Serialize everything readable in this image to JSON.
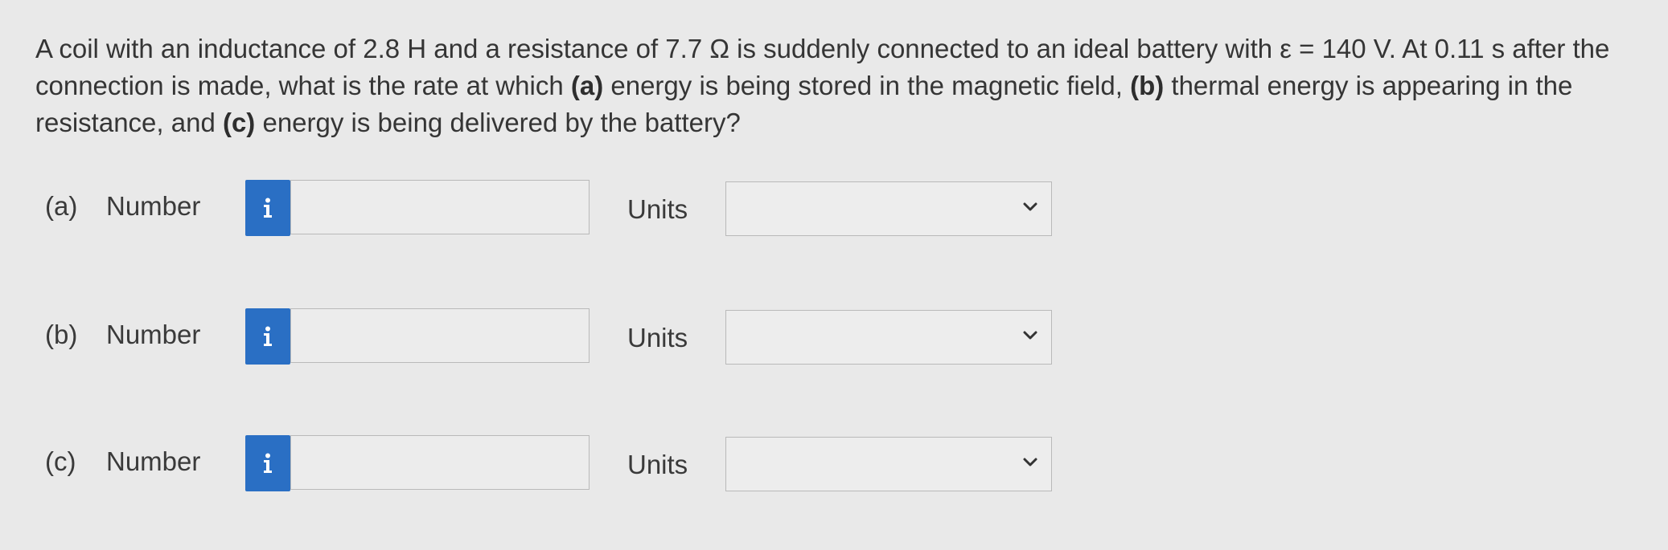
{
  "question": {
    "line1": "A coil with an inductance of 2.8 H and a resistance of 7.7 Ω is suddenly connected to an ideal battery with ε = 140 V. At 0.11 s after the",
    "line2_pre": "connection is made, what is the rate at which ",
    "line2_a": "(a)",
    "line2_mid": " energy is being stored in the magnetic field, ",
    "line2_b": "(b)",
    "line2_post": " thermal energy is appearing in the",
    "line3_pre": "resistance, and ",
    "line3_c": "(c)",
    "line3_post": " energy is being delivered by the battery?"
  },
  "parts": [
    {
      "label": "(a)",
      "number_label": "Number",
      "info": "i",
      "units_label": "Units",
      "value": "",
      "unit_selected": ""
    },
    {
      "label": "(b)",
      "number_label": "Number",
      "info": "i",
      "units_label": "Units",
      "value": "",
      "unit_selected": ""
    },
    {
      "label": "(c)",
      "number_label": "Number",
      "info": "i",
      "units_label": "Units",
      "value": "",
      "unit_selected": ""
    }
  ],
  "colors": {
    "background": "#e9e9e9",
    "info_button": "#2a6fc4",
    "border": "#b9b9b9"
  },
  "icons": {
    "info": "info-icon",
    "dropdown": "chevron-down-icon"
  }
}
